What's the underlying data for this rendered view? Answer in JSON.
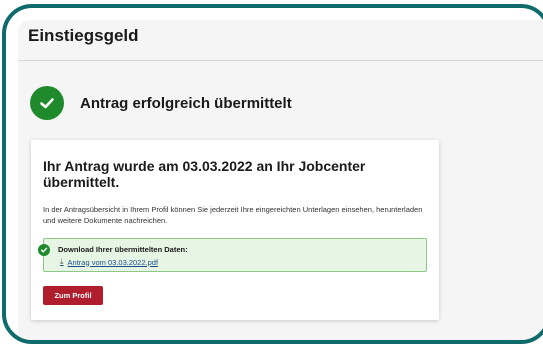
{
  "section": {
    "title": "Einstiegsgeld"
  },
  "status": {
    "message": "Antrag erfolgreich übermittelt",
    "icon": "check-circle-icon",
    "color": "#1f8a2c"
  },
  "card": {
    "title": "Ihr Antrag wurde am 03.03.2022 an Ihr Jobcenter übermittelt.",
    "description": "In der Antragsübersicht in Ihrem Profil können Sie jederzeit Ihre eingereichten Unterlagen einsehen, herunterladen und weitere Dokumente nachreichen.",
    "download": {
      "title": "Download Ihrer übermittelten Daten:",
      "link_label": "Antrag vom 03.03.2022.pdf",
      "icon": "download-icon"
    },
    "button_label": "Zum Profil"
  },
  "colors": {
    "frame": "#0f6b6b",
    "success": "#1f8a2c",
    "button": "#b01e2e",
    "download_bg": "#e7f5e4"
  }
}
